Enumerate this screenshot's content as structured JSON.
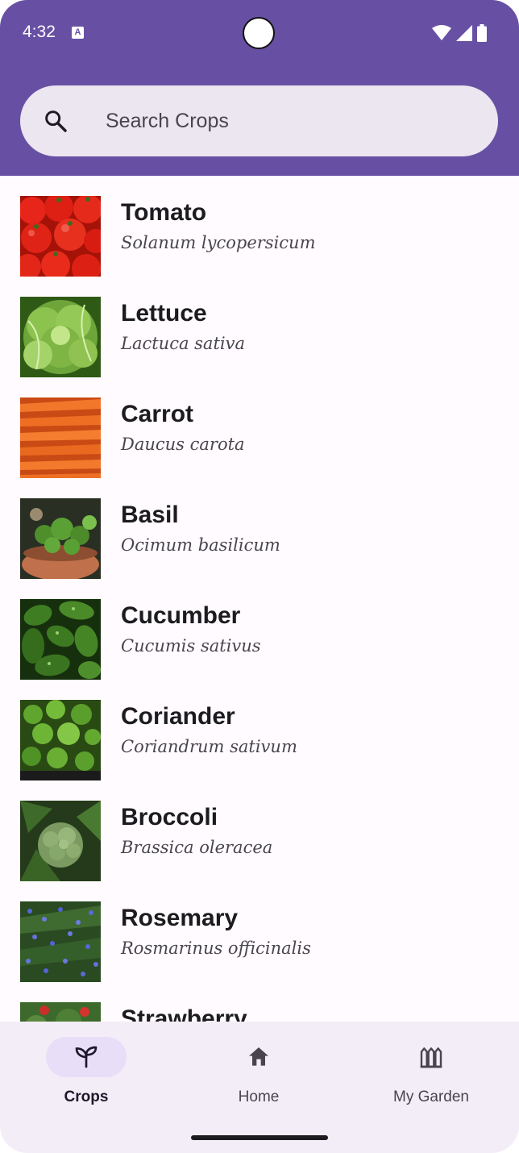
{
  "status_bar": {
    "time": "4:32",
    "notification_icon": "a-icon",
    "right_icons": [
      "wifi-icon",
      "signal-icon",
      "battery-icon"
    ]
  },
  "search": {
    "placeholder": "Search Crops",
    "value": ""
  },
  "crops": [
    {
      "name": "Tomato",
      "scientific": "Solanum lycopersicum",
      "image": "tomato"
    },
    {
      "name": "Lettuce",
      "scientific": "Lactuca sativa",
      "image": "lettuce"
    },
    {
      "name": "Carrot",
      "scientific": "Daucus carota",
      "image": "carrot"
    },
    {
      "name": "Basil",
      "scientific": "Ocimum basilicum",
      "image": "basil"
    },
    {
      "name": "Cucumber",
      "scientific": "Cucumis sativus",
      "image": "cucumber"
    },
    {
      "name": "Coriander",
      "scientific": "Coriandrum sativum",
      "image": "coriander"
    },
    {
      "name": "Broccoli",
      "scientific": "Brassica oleracea",
      "image": "broccoli"
    },
    {
      "name": "Rosemary",
      "scientific": "Rosmarinus officinalis",
      "image": "rosemary"
    },
    {
      "name": "Strawberry",
      "scientific": "",
      "image": "strawberry"
    }
  ],
  "nav": {
    "items": [
      {
        "label": "Crops",
        "icon": "sprout-icon",
        "active": true
      },
      {
        "label": "Home",
        "icon": "home-icon",
        "active": false
      },
      {
        "label": "My Garden",
        "icon": "garden-fence-icon",
        "active": false
      }
    ]
  },
  "colors": {
    "primary": "#6750a4",
    "surface": "#fffbfe",
    "search_bg": "#ece6f0",
    "nav_bg": "#f3edf7",
    "nav_indicator": "#e8def8"
  }
}
